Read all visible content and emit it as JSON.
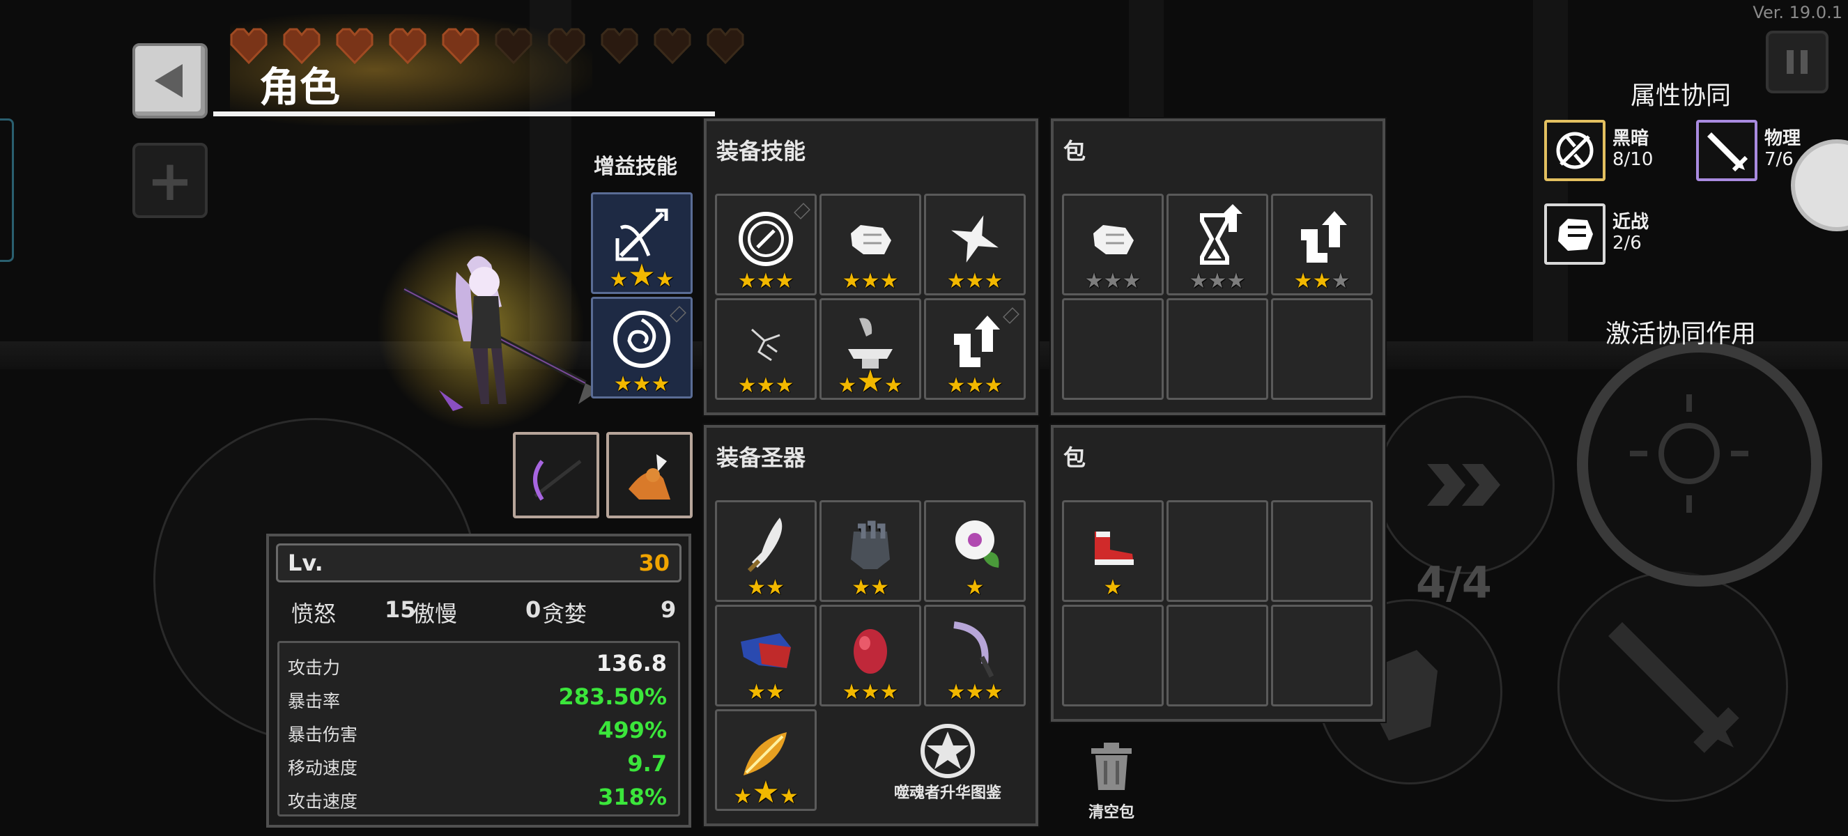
{
  "version": "Ver. 19.0.1",
  "header": {
    "title": "角色"
  },
  "hearts": {
    "filled": 5,
    "total": 10
  },
  "buff_skills": {
    "title": "增益技能",
    "slots": [
      {
        "icon": "crossbow-buff-icon",
        "stars": 3,
        "highlight": 2
      },
      {
        "icon": "rose-shield-icon",
        "stars": 3,
        "highlight": 0
      }
    ]
  },
  "weapon_slots": [
    "scythe-icon",
    "fox-pet-icon"
  ],
  "equipped_skills": {
    "title": "装备技能",
    "slots": [
      {
        "icon": "clock-ring-icon",
        "stars": 3,
        "dim": 0,
        "highlight": 0
      },
      {
        "icon": "fist-icon",
        "stars": 3,
        "dim": 0,
        "highlight": 0
      },
      {
        "icon": "shuriken-icon",
        "stars": 3,
        "dim": 0,
        "highlight": 0
      },
      {
        "icon": "crack-icon",
        "stars": 3,
        "dim": 0,
        "highlight": 0
      },
      {
        "icon": "anvil-icon",
        "stars": 3,
        "dim": 0,
        "highlight": 2
      },
      {
        "icon": "boot-arrow-icon",
        "stars": 3,
        "dim": 0,
        "highlight": 0
      }
    ]
  },
  "skill_bag": {
    "title": "包",
    "slots": [
      {
        "icon": "fist-icon",
        "stars": 3,
        "dim": 3,
        "highlight": 0
      },
      {
        "icon": "hourglass-icon",
        "stars": 3,
        "dim": 3,
        "highlight": 0
      },
      {
        "icon": "boot-arrow-icon",
        "stars": 3,
        "dim": 1,
        "highlight": 0
      },
      null,
      null,
      null
    ]
  },
  "equipped_relics": {
    "title": "装备圣器",
    "slots": [
      {
        "icon": "blade-icon",
        "stars": 2,
        "dim": 0,
        "highlight": 0
      },
      {
        "icon": "gauntlet-icon",
        "stars": 2,
        "dim": 0,
        "highlight": 0
      },
      {
        "icon": "flower-icon",
        "stars": 1,
        "dim": 0,
        "highlight": 0
      },
      {
        "icon": "cape-icon",
        "stars": 2,
        "dim": 0,
        "highlight": 0
      },
      {
        "icon": "red-egg-icon",
        "stars": 3,
        "dim": 0,
        "highlight": 0
      },
      {
        "icon": "purple-scythe-icon",
        "stars": 3,
        "dim": 0,
        "highlight": 0
      },
      {
        "icon": "golden-feather-icon",
        "stars": 3,
        "dim": 0,
        "highlight": 2
      }
    ]
  },
  "relic_bag": {
    "title": "包",
    "slots": [
      {
        "icon": "red-boot-icon",
        "stars": 1,
        "dim": 0,
        "highlight": 0
      },
      null,
      null,
      null,
      null,
      null
    ]
  },
  "stats": {
    "level_label": "Lv.",
    "level": "30",
    "sins": [
      {
        "label": "愤怒",
        "value": "15"
      },
      {
        "label": "傲慢",
        "value": "0"
      },
      {
        "label": "贪婪",
        "value": "9"
      }
    ],
    "rows": [
      {
        "label": "攻击力",
        "value": "136.8",
        "color": "#f0f0f0"
      },
      {
        "label": "暴击率",
        "value": "283.50%",
        "color": "#3be63b"
      },
      {
        "label": "暴击伤害",
        "value": "499%",
        "color": "#3be63b"
      },
      {
        "label": "移动速度",
        "value": "9.7",
        "color": "#3be63b"
      },
      {
        "label": "攻击速度",
        "value": "318%",
        "color": "#3be63b"
      }
    ]
  },
  "buttons": {
    "codex": "噬魂者升华图鉴",
    "clear_bag": "清空包"
  },
  "synergy": {
    "title": "属性协同",
    "items": [
      {
        "name": "黑暗",
        "count": "8/10",
        "border": "#e3c060"
      },
      {
        "name": "物理",
        "count": "7/6",
        "border": "#a98be0"
      },
      {
        "name": "近战",
        "count": "2/6",
        "border": "#d9d9d9"
      }
    ],
    "activate": "激活协同作用"
  },
  "hud": {
    "counter": "4/4"
  },
  "colors": {
    "star": "#f2b800",
    "star_dim": "#7d7d7d",
    "accent_green": "#3be63b",
    "level_orange": "#f0a400"
  }
}
